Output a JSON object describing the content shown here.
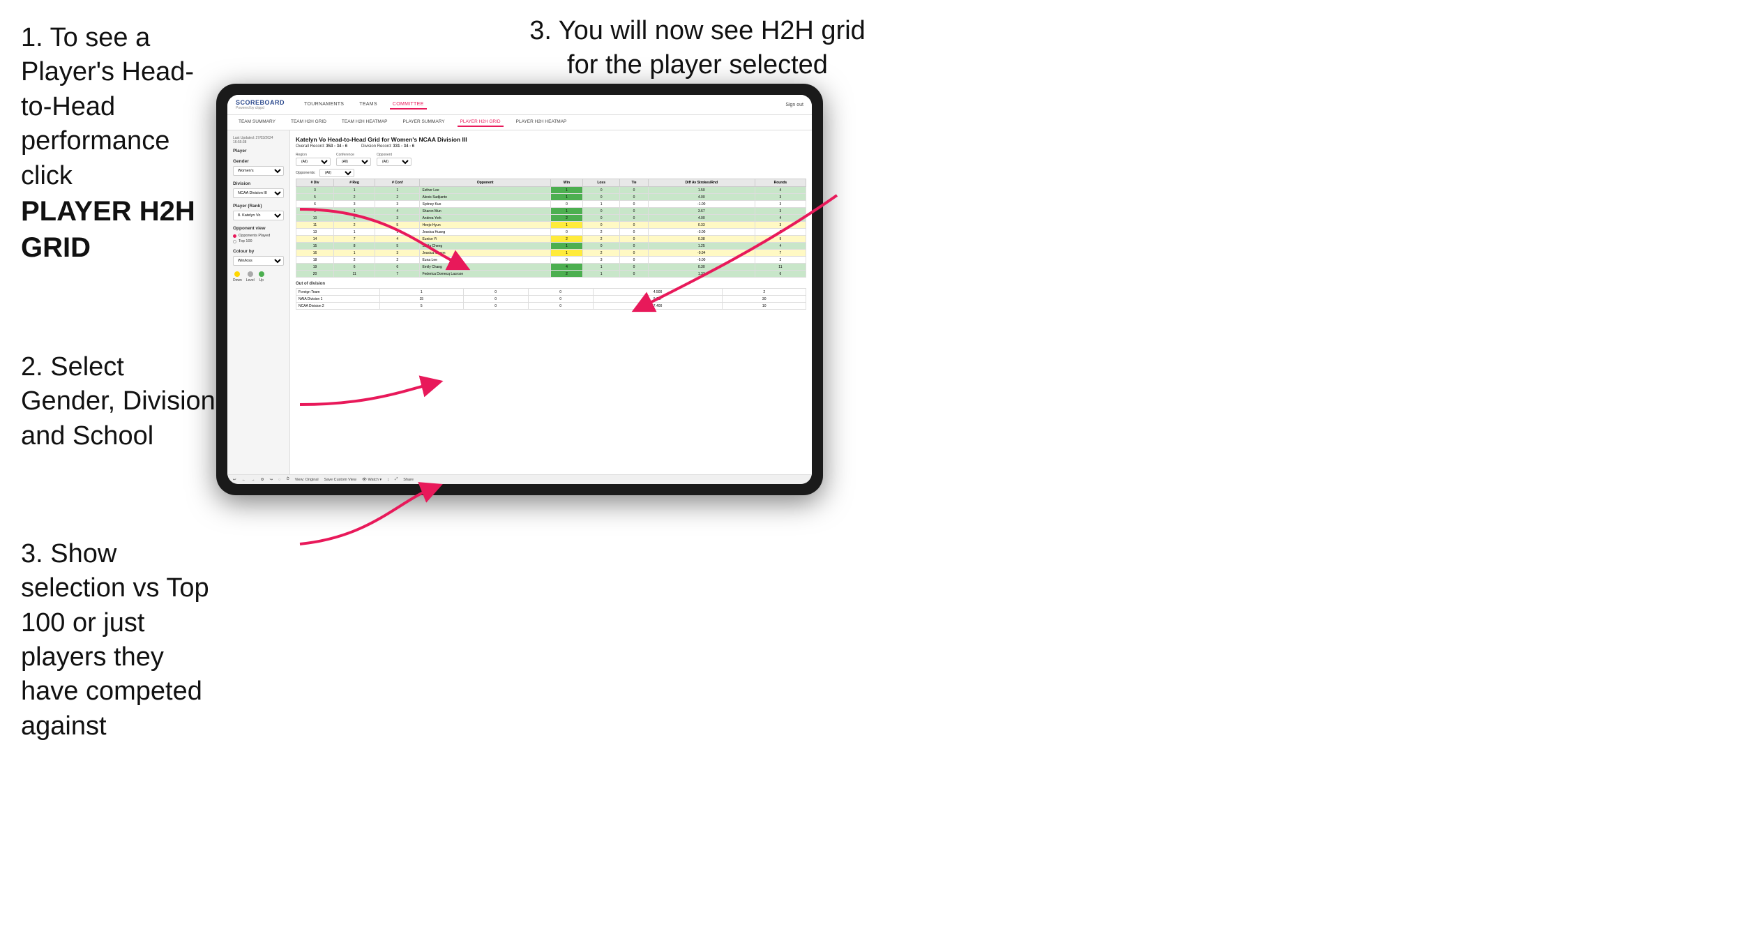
{
  "instructions": {
    "step1": {
      "text": "1. To see a Player's Head-to-Head performance click",
      "bold": "PLAYER H2H GRID"
    },
    "step2": {
      "text": "2. Select Gender, Division and School"
    },
    "step3_left": {
      "text": "3. Show selection vs Top 100 or just players they have competed against"
    },
    "step3_right": {
      "text": "3. You will now see H2H grid for the player selected"
    }
  },
  "nav": {
    "logo": "SCOREBOARD",
    "logo_sub": "Powered by clippd",
    "items": [
      "TOURNAMENTS",
      "TEAMS",
      "COMMITTEE"
    ],
    "active_item": "COMMITTEE",
    "sign_out": "Sign out"
  },
  "sub_nav": {
    "items": [
      "TEAM SUMMARY",
      "TEAM H2H GRID",
      "TEAM H2H HEATMAP",
      "PLAYER SUMMARY",
      "PLAYER H2H GRID",
      "PLAYER H2H HEATMAP"
    ],
    "active_item": "PLAYER H2H GRID"
  },
  "sidebar": {
    "timestamp": "Last Updated: 27/03/2024 16:55:38",
    "player_label": "Player",
    "gender_label": "Gender",
    "gender_value": "Women's",
    "division_label": "Division",
    "division_value": "NCAA Division III",
    "player_rank_label": "Player (Rank)",
    "player_rank_value": "8. Katelyn Vo",
    "opponent_view_label": "Opponent view",
    "radio_options": [
      "Opponents Played",
      "Top 100"
    ],
    "selected_radio": "Opponents Played",
    "colour_by_label": "Colour by",
    "colour_by_value": "Win/loss",
    "legend": {
      "down_label": "Down",
      "level_label": "Level",
      "up_label": "Up",
      "down_color": "#FFD700",
      "level_color": "#aaaaaa",
      "up_color": "#4CAF50"
    }
  },
  "grid": {
    "title": "Katelyn Vo Head-to-Head Grid for Women's NCAA Division III",
    "overall_record": "353 - 34 - 6",
    "division_record": "331 - 34 - 6",
    "filters": {
      "region_label": "Region",
      "conference_label": "Conference",
      "opponent_label": "Opponent",
      "opponents_label": "Opponents:",
      "region_value": "(All)",
      "conference_value": "(All)",
      "opponent_value": "(All)"
    },
    "table_headers": [
      "# Div",
      "# Reg",
      "# Conf",
      "Opponent",
      "Win",
      "Loss",
      "Tie",
      "Diff Av Strokes/Rnd",
      "Rounds"
    ],
    "rows": [
      {
        "div": 3,
        "reg": 1,
        "conf": 1,
        "opponent": "Esther Lee",
        "win": 1,
        "loss": 0,
        "tie": 0,
        "diff": 1.5,
        "rounds": 4,
        "color": "green"
      },
      {
        "div": 5,
        "reg": 2,
        "conf": 2,
        "opponent": "Alexis Sudjianto",
        "win": 1,
        "loss": 0,
        "tie": 0,
        "diff": 4.0,
        "rounds": 3,
        "color": "green"
      },
      {
        "div": 6,
        "reg": 3,
        "conf": 3,
        "opponent": "Sydney Kuo",
        "win": 0,
        "loss": 1,
        "tie": 0,
        "diff": -1.0,
        "rounds": 3,
        "color": "white"
      },
      {
        "div": 9,
        "reg": 1,
        "conf": 4,
        "opponent": "Sharon Mun",
        "win": 1,
        "loss": 0,
        "tie": 0,
        "diff": 3.67,
        "rounds": 3,
        "color": "green"
      },
      {
        "div": 10,
        "reg": 6,
        "conf": 3,
        "opponent": "Andrea York",
        "win": 2,
        "loss": 0,
        "tie": 0,
        "diff": 4.0,
        "rounds": 4,
        "color": "green"
      },
      {
        "div": 11,
        "reg": 2,
        "conf": 5,
        "opponent": "Heejo Hyun",
        "win": 1,
        "loss": 0,
        "tie": 0,
        "diff": 0.33,
        "rounds": 3,
        "color": "yellow"
      },
      {
        "div": 13,
        "reg": 1,
        "conf": 1,
        "opponent": "Jessica Huang",
        "win": 0,
        "loss": 2,
        "tie": 0,
        "diff": -3.0,
        "rounds": 2,
        "color": "white"
      },
      {
        "div": 14,
        "reg": 7,
        "conf": 4,
        "opponent": "Eunice Yi",
        "win": 2,
        "loss": 2,
        "tie": 0,
        "diff": 0.38,
        "rounds": 9,
        "color": "yellow"
      },
      {
        "div": 15,
        "reg": 8,
        "conf": 5,
        "opponent": "Stella Cheng",
        "win": 1,
        "loss": 0,
        "tie": 0,
        "diff": 1.25,
        "rounds": 4,
        "color": "green"
      },
      {
        "div": 16,
        "reg": 1,
        "conf": 3,
        "opponent": "Jessica Mason",
        "win": 1,
        "loss": 2,
        "tie": 0,
        "diff": -0.94,
        "rounds": 7,
        "color": "yellow"
      },
      {
        "div": 18,
        "reg": 2,
        "conf": 2,
        "opponent": "Euna Lee",
        "win": 0,
        "loss": 3,
        "tie": 0,
        "diff": -5.0,
        "rounds": 2,
        "color": "white"
      },
      {
        "div": 19,
        "reg": 6,
        "conf": 6,
        "opponent": "Emily Chang",
        "win": 4,
        "loss": 1,
        "tie": 0,
        "diff": 0.3,
        "rounds": 11,
        "color": "green"
      },
      {
        "div": 20,
        "reg": 11,
        "conf": 7,
        "opponent": "Federica Domecq Lacroze",
        "win": 2,
        "loss": 1,
        "tie": 0,
        "diff": 1.33,
        "rounds": 6,
        "color": "green"
      }
    ],
    "out_of_division_title": "Out of division",
    "out_of_division_rows": [
      {
        "label": "Foreign Team",
        "win": 1,
        "loss": 0,
        "tie": 0,
        "diff": 4.5,
        "rounds": 2
      },
      {
        "label": "NAIA Division 1",
        "win": 15,
        "loss": 0,
        "tie": 0,
        "diff": 9.267,
        "rounds": 30
      },
      {
        "label": "NCAA Division 2",
        "win": 5,
        "loss": 0,
        "tie": 0,
        "diff": 7.4,
        "rounds": 10
      }
    ]
  },
  "toolbar": {
    "items": [
      "↩",
      "←",
      "→",
      "⚙",
      "↪",
      "◌",
      "⏱",
      "View: Original",
      "Save Custom View",
      "👁 Watch ▾",
      "↕",
      "⤢",
      "Share"
    ]
  }
}
